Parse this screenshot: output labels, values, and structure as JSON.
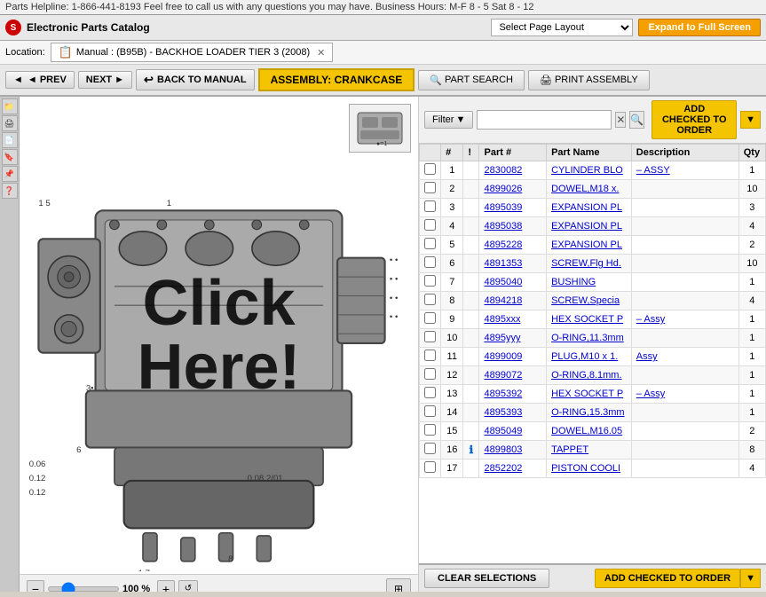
{
  "topbar": {
    "text": "Parts Helpline: 1-866-441-8193 Feel free to call us with any questions you may have. Business Hours: M-F 8 - 5 Sat 8 - 12"
  },
  "header": {
    "app_title": "Electronic Parts Catalog",
    "select_page_label": "Select Page Layout",
    "expand_btn": "Expand to Full Screen"
  },
  "location": {
    "label": "Location:"
  },
  "tab": {
    "title": "Manual : (B95B) - BACKHOE LOADER TIER 3 (2008)"
  },
  "toolbar": {
    "prev_btn": "◄ PREV",
    "next_btn": "NEXT ►",
    "back_btn": "BACK TO MANUAL",
    "assembly_label": "ASSEMBLY: CRANKCASE",
    "part_search_btn": "PART SEARCH",
    "print_btn": "PRINT ASSEMBLY"
  },
  "filter": {
    "filter_btn": "Filter",
    "placeholder": "",
    "add_checked_btn": "ADD CHECKED TO ORDER"
  },
  "table": {
    "headers": [
      "",
      "#",
      "!",
      "Part #",
      "Part Name",
      "Description",
      "Qty"
    ],
    "rows": [
      {
        "num": "1",
        "warn": "",
        "part": "2830082",
        "name": "CYLINDER BLO",
        "desc": "– ASSY",
        "qty": "1"
      },
      {
        "num": "2",
        "warn": "",
        "part": "4899026",
        "name": "DOWEL,M18 x.",
        "desc": "",
        "qty": "10"
      },
      {
        "num": "3",
        "warn": "",
        "part": "4895039",
        "name": "EXPANSION PL",
        "desc": "",
        "qty": "3"
      },
      {
        "num": "4",
        "warn": "",
        "part": "4895038",
        "name": "EXPANSION PL",
        "desc": "",
        "qty": "4"
      },
      {
        "num": "5",
        "warn": "",
        "part": "4895228",
        "name": "EXPANSION PL",
        "desc": "",
        "qty": "2"
      },
      {
        "num": "6",
        "warn": "",
        "part": "4891353",
        "name": "SCREW,Flg Hd.",
        "desc": "",
        "qty": "10"
      },
      {
        "num": "7",
        "warn": "",
        "part": "4895040",
        "name": "BUSHING",
        "desc": "",
        "qty": "1"
      },
      {
        "num": "8",
        "warn": "",
        "part": "4894218",
        "name": "SCREW,Specia",
        "desc": "",
        "qty": "4"
      },
      {
        "num": "9",
        "warn": "",
        "part": "4895xxx",
        "name": "HEX SOCKET P",
        "desc": "– Assy",
        "qty": "1"
      },
      {
        "num": "10",
        "warn": "",
        "part": "4895yyy",
        "name": "O-RING,11.3mm",
        "desc": "",
        "qty": "1"
      },
      {
        "num": "11",
        "warn": "",
        "part": "4899009",
        "name": "PLUG,M10 x 1.",
        "desc": "Assy",
        "qty": "1"
      },
      {
        "num": "12",
        "warn": "",
        "part": "4899072",
        "name": "O-RING,8.1mm.",
        "desc": "",
        "qty": "1"
      },
      {
        "num": "13",
        "warn": "",
        "part": "4895392",
        "name": "HEX SOCKET P",
        "desc": "– Assy",
        "qty": "1"
      },
      {
        "num": "14",
        "warn": "",
        "part": "4895393",
        "name": "O-RING,15.3mm",
        "desc": "",
        "qty": "1"
      },
      {
        "num": "15",
        "warn": "",
        "part": "4895049",
        "name": "DOWEL,M16.05",
        "desc": "",
        "qty": "2"
      },
      {
        "num": "16",
        "warn": "!",
        "part": "4899803",
        "name": "TAPPET",
        "desc": "",
        "qty": "8"
      },
      {
        "num": "17",
        "warn": "",
        "part": "2852202",
        "name": "PISTON COOLI",
        "desc": "",
        "qty": "4"
      }
    ]
  },
  "diagram": {
    "click_here": "Click Here!",
    "zoom_percent": "100 %"
  },
  "bottom": {
    "clear_btn": "CLEAR SELECTIONS",
    "add_checked_btn": "ADD CHECKED TO ORDER"
  }
}
